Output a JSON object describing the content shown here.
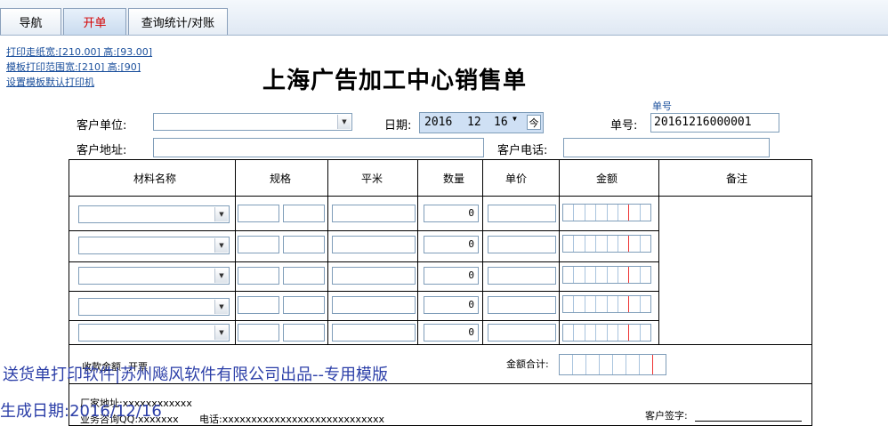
{
  "tabs": [
    "导航",
    "开单",
    "查询统计/对账"
  ],
  "links": {
    "paper_size": "打印走纸宽:[210.00] 高:[93.00]",
    "print_range": "模板打印范围宽:[210] 高:[90]",
    "set_printer": "设置模板默认打印机"
  },
  "title": "上海广告加工中心销售单",
  "header": {
    "customer_unit_label": "客户单位:",
    "date_label": "日期:",
    "date": {
      "year": "2016",
      "month": "12",
      "day": "16",
      "today_button": "今"
    },
    "order_no_caption": "单号",
    "order_no_label": "单号:",
    "order_no": "20161216000001",
    "address_label": "客户地址:",
    "phone_label": "客户电话:"
  },
  "table": {
    "columns": [
      "材料名称",
      "规格",
      "平米",
      "数量",
      "单价",
      "金额",
      "备注"
    ],
    "rows": [
      {
        "qty": "0"
      },
      {
        "qty": "0"
      },
      {
        "qty": "0"
      },
      {
        "qty": "0"
      },
      {
        "qty": "0"
      }
    ],
    "total_label": "金额合计:",
    "receivable_label": "收款金额",
    "sales_label": "开票"
  },
  "footer": {
    "address_line": "厂家地址:xxxxxxxxxxxx",
    "contact_line": "业务咨询QQ:xxxxxxx",
    "phone_line": "电话:xxxxxxxxxxxxxxxxxxxxxxxxxxxx",
    "signature_label": "客户签字:"
  },
  "watermark": {
    "line1": "送货单打印软件|苏州飚风软件有限公司出品--专用模版",
    "line2": "生成日期:2016/12/16"
  },
  "colors": {
    "active_tab_text": "#d40000",
    "link": "#1a4f9c",
    "watermark": "#2c3fa8"
  }
}
